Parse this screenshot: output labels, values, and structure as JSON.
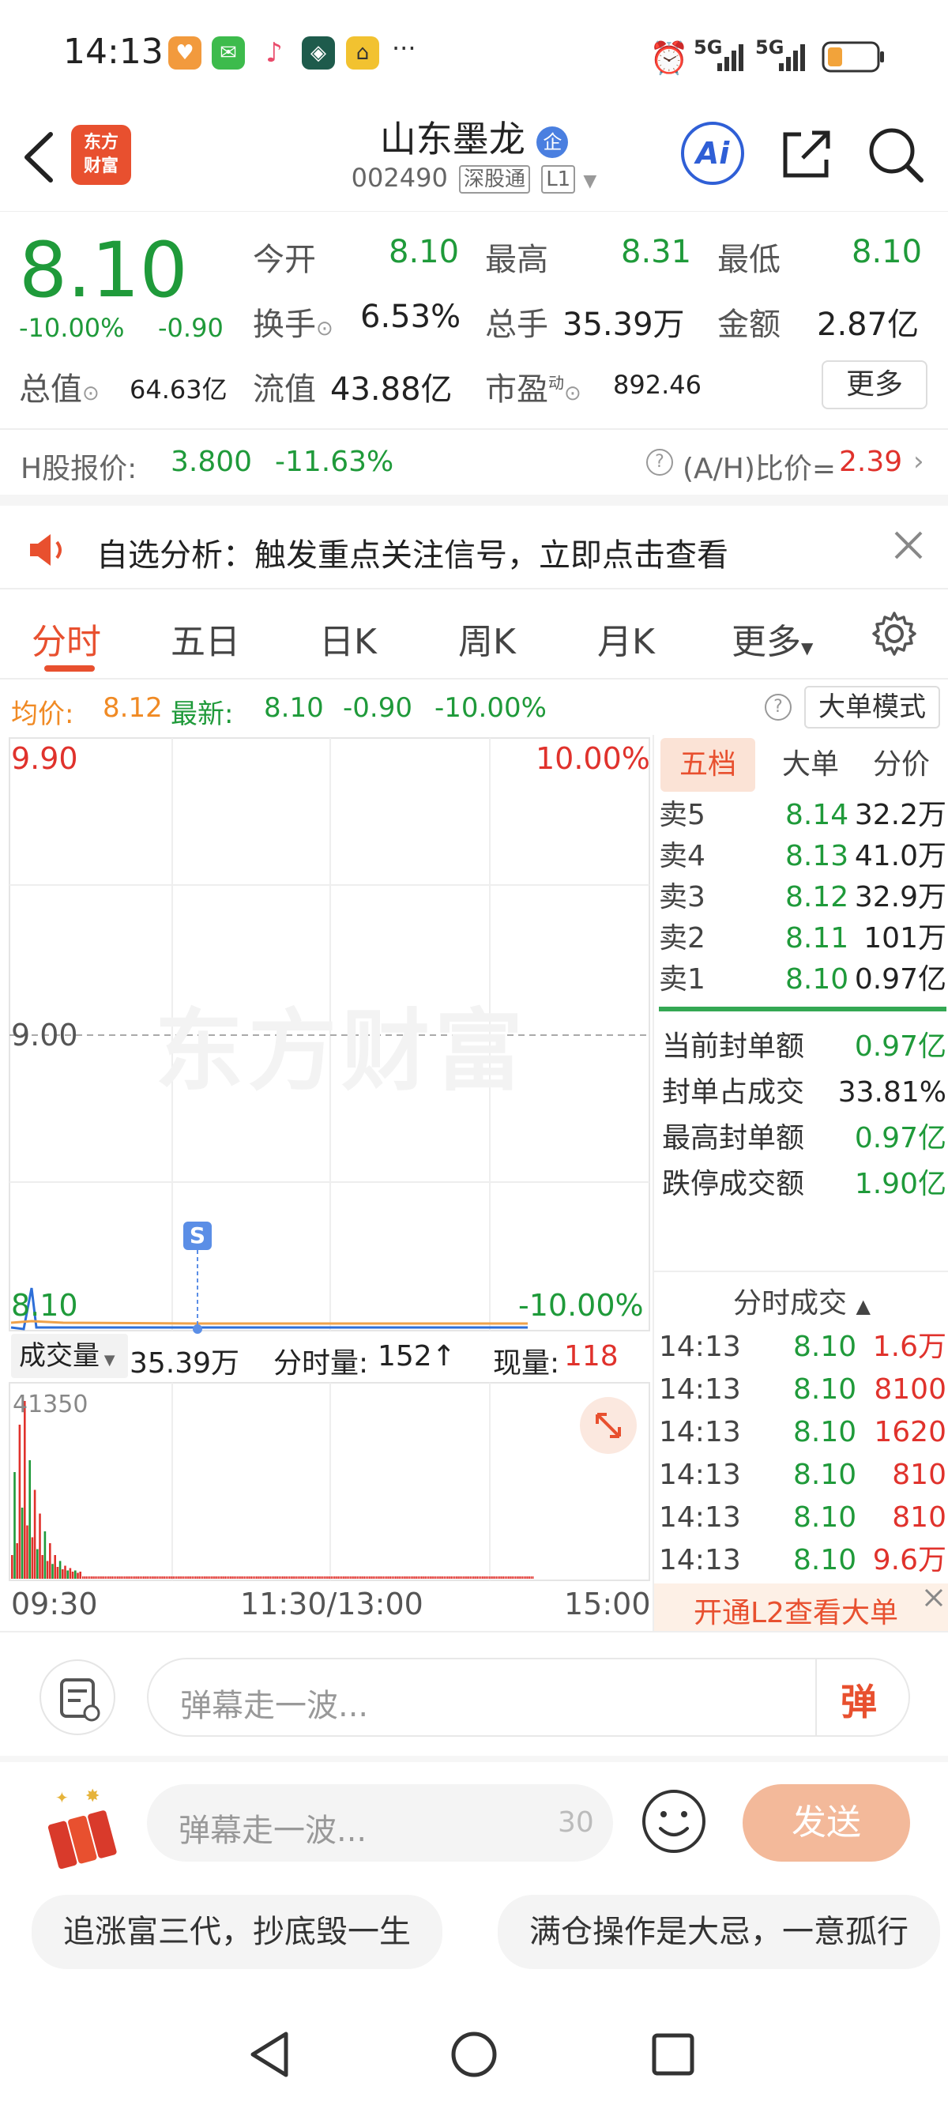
{
  "status_bar": {
    "time": "14:13",
    "signal1": "5G",
    "signal2": "5G",
    "more": "···"
  },
  "header": {
    "logo_line1": "东方",
    "logo_line2": "财富",
    "stock_name": "山东墨龙",
    "enterprise_badge": "企",
    "stock_code": "002490",
    "tag_connect": "深股通",
    "tag_level": "L1",
    "ai_label": "Ai"
  },
  "quote": {
    "price": "8.10",
    "change_pct": "-10.00%",
    "change_abs": "-0.90",
    "open_label": "今开",
    "open": "8.10",
    "high_label": "最高",
    "high": "8.31",
    "low_label": "最低",
    "low": "8.10",
    "turnover_label": "换手",
    "turnover": "6.53%",
    "volume_label": "总手",
    "volume": "35.39万",
    "amount_label": "金额",
    "amount": "2.87亿",
    "mktcap_label": "总值",
    "mktcap": "64.63亿",
    "float_label": "流值",
    "float": "43.88亿",
    "pe_label": "市盈",
    "pe_sup": "动",
    "pe": "892.46",
    "more_button": "更多"
  },
  "hshare": {
    "label": "H股报价:",
    "price": "3.800",
    "pct": "-11.63%",
    "ratio_label": "(A/H)比价=",
    "ratio": "2.39"
  },
  "banner": {
    "text": "自选分析：触发重点关注信号，立即点击查看"
  },
  "tabs": [
    "分时",
    "五日",
    "日K",
    "周K",
    "月K",
    "更多"
  ],
  "active_tab": 0,
  "avg_bar": {
    "avg_label": "均价:",
    "avg": "8.12",
    "latest_label": "最新:",
    "latest": "8.10",
    "chg": "-0.90",
    "pct": "-10.00%",
    "mode_button": "大单模式"
  },
  "chart": {
    "y_top": "9.90",
    "y_mid": "9.00",
    "y_bottom": "8.10",
    "pct_top": "10.00%",
    "pct_bottom": "-10.00%",
    "watermark": "东方财富",
    "marker": "S",
    "vol_dropdown": "成交量",
    "vol_total": "35.39万",
    "minute_vol_label": "分时量:",
    "minute_vol": "152",
    "current_label": "现量:",
    "current": "118",
    "vol_axis_max": "41350",
    "time_start": "09:30",
    "time_mid": "11:30/13:00",
    "time_end": "15:00"
  },
  "order_book": {
    "tabs": [
      "五档",
      "大单",
      "分价"
    ],
    "asks": [
      {
        "label": "卖5",
        "price": "8.14",
        "vol": "32.2万"
      },
      {
        "label": "卖4",
        "price": "8.13",
        "vol": "41.0万"
      },
      {
        "label": "卖3",
        "price": "8.12",
        "vol": "32.9万"
      },
      {
        "label": "卖2",
        "price": "8.11",
        "vol": "101万"
      },
      {
        "label": "卖1",
        "price": "8.10",
        "vol": "0.97亿"
      }
    ],
    "stats": [
      {
        "label": "当前封单额",
        "value": "0.97亿",
        "color": "green"
      },
      {
        "label": "封单占成交",
        "value": "33.81%",
        "color": "dark"
      },
      {
        "label": "最高封单额",
        "value": "0.97亿",
        "color": "green"
      },
      {
        "label": "跌停成交额",
        "value": "1.90亿",
        "color": "green"
      }
    ],
    "trades_title": "分时成交",
    "trades": [
      {
        "time": "14:13",
        "price": "8.10",
        "vol": "1.6万"
      },
      {
        "time": "14:13",
        "price": "8.10",
        "vol": "8100"
      },
      {
        "time": "14:13",
        "price": "8.10",
        "vol": "1620"
      },
      {
        "time": "14:13",
        "price": "8.10",
        "vol": "810"
      },
      {
        "time": "14:13",
        "price": "8.10",
        "vol": "810"
      },
      {
        "time": "14:13",
        "price": "8.10",
        "vol": "9.6万"
      }
    ],
    "l2_banner": "开通L2查看大单"
  },
  "danmaku_bar": {
    "placeholder": "弹幕走一波...",
    "toggle": "弹"
  },
  "comment_bar": {
    "placeholder": "弹幕走一波...",
    "count": "30",
    "send": "发送"
  },
  "chips": [
    "追涨富三代，抄底毁一生",
    "满仓操作是大忌，一意孤行"
  ],
  "colors": {
    "accent": "#e8502f",
    "up": "#e0322c",
    "down": "#1f9a3a",
    "avg": "#f08a24",
    "send_bg": "#f3b99a"
  }
}
